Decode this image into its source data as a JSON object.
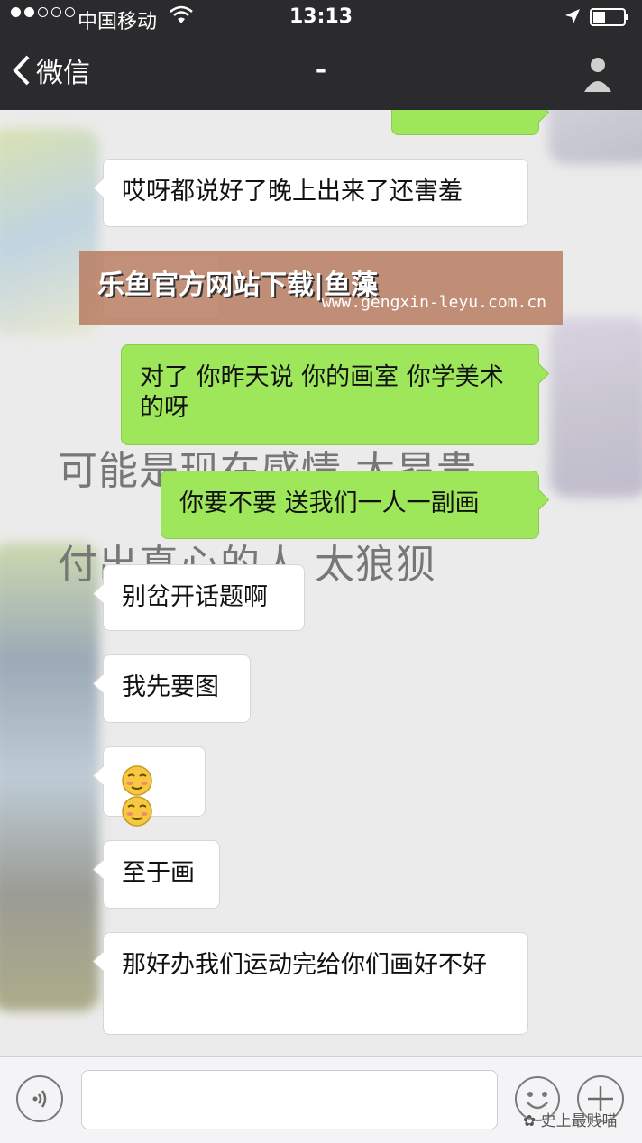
{
  "status_bar": {
    "carrier": "中国移动",
    "time": "13:13"
  },
  "nav": {
    "back_label": "微信",
    "title": "-"
  },
  "watermark": {
    "title": "乐鱼官方网站下载|鱼藻",
    "url": "www.gengxin-leyu.com.cn"
  },
  "overlay_lines": [
    "可能是现在感情 太昂贵",
    "付出真心的人 太狼狈"
  ],
  "messages": [
    {
      "side": "in",
      "text": "哎呀都说好了晚上出来了还害羞"
    },
    {
      "side": "out",
      "text": "对了 你昨天说 你的画室 你学美术的呀"
    },
    {
      "side": "out",
      "text": "你要不要 送我们一人一副画"
    },
    {
      "side": "in",
      "text": "别岔开话题啊"
    },
    {
      "side": "in",
      "text": "我先要图"
    },
    {
      "side": "in",
      "text": "",
      "emoji": "smirk-emoji x2"
    },
    {
      "side": "in",
      "text": "至于画"
    },
    {
      "side": "in",
      "text": "那好办我们运动完给你们画好不好"
    }
  ],
  "input_bar": {
    "value": "",
    "source_watermark": "史上最贱喵"
  }
}
